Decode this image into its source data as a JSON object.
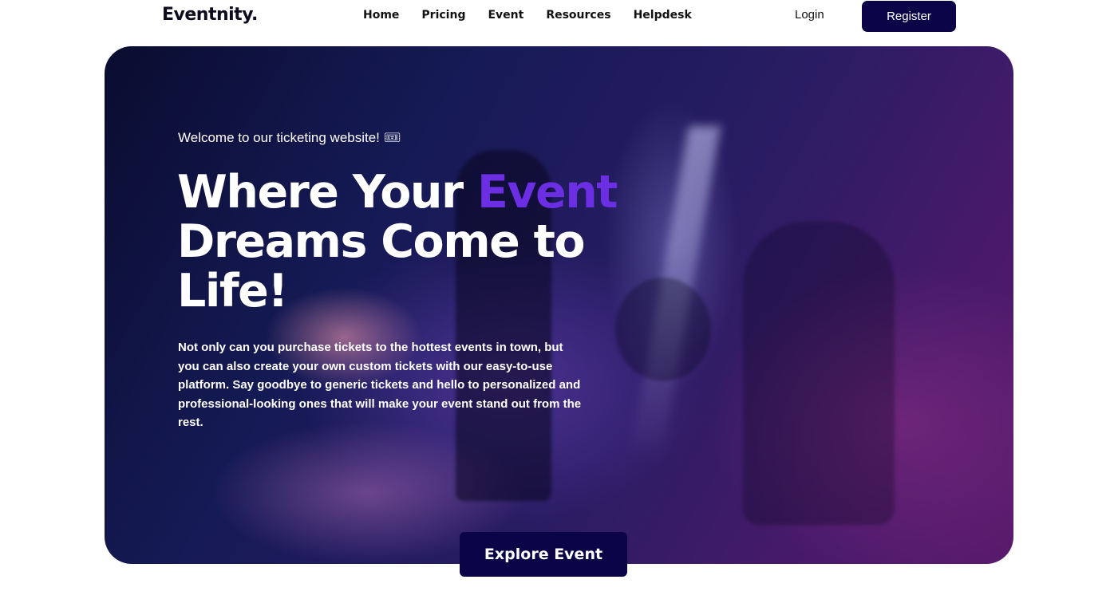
{
  "header": {
    "logo": "Eventnity.",
    "nav": [
      "Home",
      "Pricing",
      "Event",
      "Resources",
      "Helpdesk"
    ],
    "login_label": "Login",
    "register_label": "Register"
  },
  "hero": {
    "welcome": "Welcome to our ticketing website! 🎟",
    "headline_part1": "Where Your ",
    "headline_accent": "Event",
    "headline_part2": " Dreams Come to Life!",
    "description": "Not only can you purchase tickets to the hottest events in town, but you can also create your own custom tickets with our easy-to-use platform. Say goodbye to generic tickets and hello to personalized and professional-looking ones that will make your event stand out from the rest.",
    "cta_label": "Explore Event"
  },
  "colors": {
    "brand_dark": "#0b0548",
    "accent": "#6c2ee3"
  }
}
